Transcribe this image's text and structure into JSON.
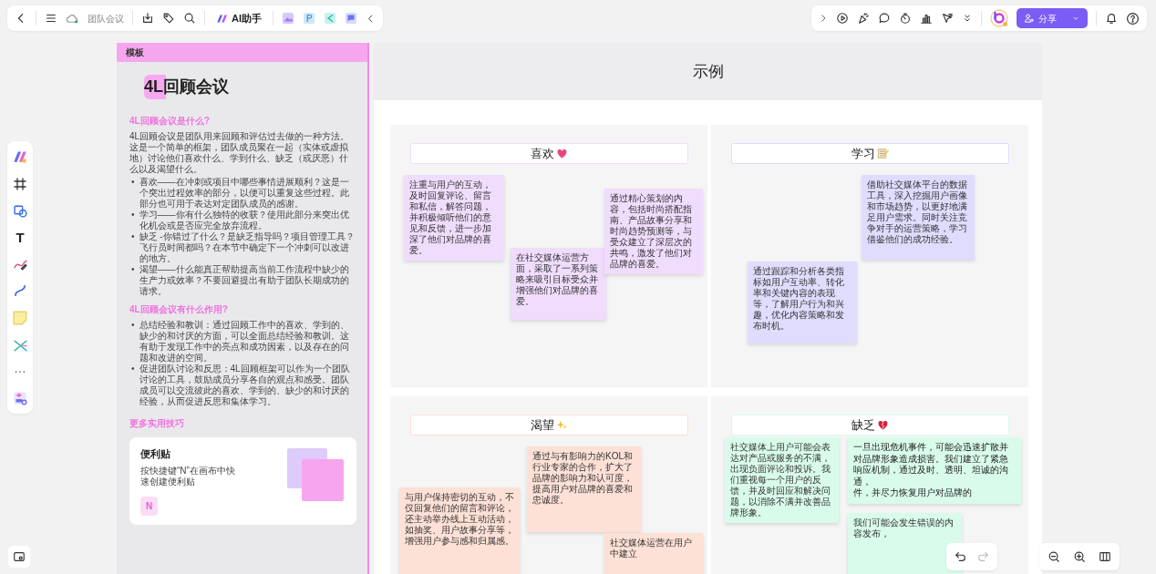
{
  "toolbar_left": {
    "doc_title": "团队会议",
    "ai_label": "AI助手"
  },
  "toolbar_right": {
    "share_label": "分享"
  },
  "tool_rail": {
    "text_tool_glyph": "T"
  },
  "template_panel": {
    "header": "模板",
    "title": "4L回顾会议",
    "sections": [
      {
        "heading": "4L回顾会议是什么?",
        "bullet_marker": "•",
        "paragraph": "4L回顾会议是团队用来回顾和评估过去做的一种方法。这是一个简单的框架，团队成员聚在一起（实体或虚拟地）讨论他们喜欢什么、学到什么、缺乏（或厌恶）什么以及渴望什么。",
        "bullets": [
          "喜欢——在冲刺或项目中哪些事情进展顺利？这是一个突出过程效率的部分，以便可以重复这些过程。此部分也可用于表达对定团队成员的感谢。",
          "学习——你有什么独特的收获？使用此部分来突出优化机会或是否应完全放弃流程。",
          "缺乏 -你错过了什么？是缺乏指导吗？项目管理工具？飞行员时间都吗？在本节中确定下一个冲刺可以改进的地方。",
          "渴望——什么能真正帮助提高当前工作流程中缺少的生产力或效率？不要回避提出有助于团队长期成功的请求。"
        ]
      },
      {
        "heading": "4L回顾会议有什么作用?",
        "bullet_marker": "•",
        "bullets": [
          "总结经验和教训：通过回顾工作中的喜欢、学到的、缺少的和讨厌的方面，可以全面总结经验和教训。这有助于发现工作中的亮点和成功因素，以及存在的问题和改进的空间。",
          "促进团队讨论和反思：4L回顾框架可以作为一个团队讨论的工具，鼓励成员分享各自的观点和感受。团队成员可以交流彼此的喜欢、学到的、缺少的和讨厌的经验，从而促进反思和集体学习。"
        ]
      }
    ],
    "tips_heading": "更多实用技巧",
    "tip_card": {
      "title": "便利贴",
      "text": "按快捷键“N”在画布中快速创建便利贴",
      "key": "N"
    }
  },
  "board": {
    "title": "示例",
    "quadrants": [
      {
        "label": "喜欢",
        "kind": "heart",
        "color": "#f0dcfc",
        "notes": [
          {
            "text": "注重与用户的互动，及时回复评论、留言和私信，解答问题，并积极倾听他们的意见和反馈，进一步加深了他们对品牌的喜爱。"
          },
          {
            "text": "在社交媒体运营方面，采取了一系列策略来吸引目标受众并增强他们对品牌的喜爱。"
          },
          {
            "text": "通过精心策划的内容，包括时尚搭配指南、产品故事分享和时尚趋势预测等，与受众建立了深层次的共鸣，激发了他们对品牌的喜爱。"
          }
        ]
      },
      {
        "label": "学习",
        "kind": "memo",
        "color": "#dfdcfd",
        "notes": [
          {
            "text": "借助社交媒体平台的数据工具，深入挖掘用户画像和市场趋势，以更好地满足用户需求。同时关注竞争对手的运营策略，学习借鉴他们的成功经验。"
          },
          {
            "text": "通过跟踪和分析各类指标如用户互动率、转化率和关键内容的表现等，了解用户行为和兴趣，优化内容策略和发布时机。"
          }
        ]
      },
      {
        "label": "渴望",
        "kind": "sparkles",
        "color": "#fde0d6",
        "notes": [
          {
            "text": "通过与有影响力的KOL和行业专家的合作，扩大了品牌的影响力和认可度，提高用户对品牌的喜爱和忠诚度。"
          },
          {
            "text": "与用户保持密切的互动，不仅回复他们的留言和评论，还主动举办线上互动活动，如抽奖、用户故事分享等，增强用户参与感和归属感。"
          },
          {
            "text": "社交媒体运营在用户中建立"
          }
        ]
      },
      {
        "label": "缺乏",
        "kind": "broken-heart",
        "color": "#d9fbea",
        "notes": [
          {
            "text": "社交媒体上用户可能会表达对产品或服务的不满，出现负面评论和投诉。我们重视每一个用户的反馈，并及时回应和解决问题，以消除不满并改善品牌形象。"
          },
          {
            "text": "一旦出现危机事件，可能会迅速扩散并对品牌形象造成损害。我们建立了紧急响应机制，通过及时、透明、坦诚的沟通，",
            "tail": "件，并尽力恢复用户对品牌的"
          },
          {
            "text": "我们可能会发生错误的内容发布，"
          }
        ]
      }
    ]
  }
}
